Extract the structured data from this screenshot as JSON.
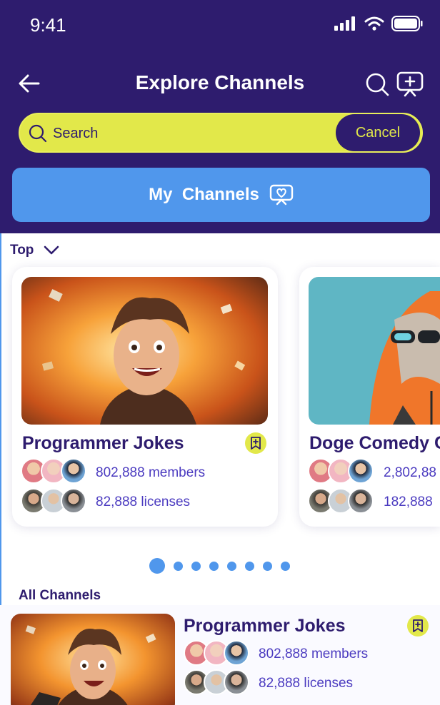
{
  "status": {
    "time": "9:41"
  },
  "header": {
    "title": "Explore Channels"
  },
  "search": {
    "placeholder": "Search",
    "cancel": "Cancel"
  },
  "my_channels": {
    "label": "My  Channels"
  },
  "sort": {
    "label": "Top"
  },
  "top_channels": [
    {
      "title": "Programmer Jokes",
      "members": "802,888 members",
      "licenses": "82,888 licenses"
    },
    {
      "title": "Doge Comedy Cl",
      "members": "2,802,88",
      "licenses": "182,888"
    }
  ],
  "carousel": {
    "active_index": 0,
    "count": 8
  },
  "all_channels": {
    "label": "All Channels",
    "items": [
      {
        "title": "Programmer Jokes",
        "members": "802,888 members",
        "licenses": "82,888 licenses"
      }
    ]
  },
  "colors": {
    "header_bg": "#2e1c6e",
    "accent_yellow": "#e2e84a",
    "accent_blue": "#5097ec",
    "stat_text": "#4b3bc0"
  }
}
